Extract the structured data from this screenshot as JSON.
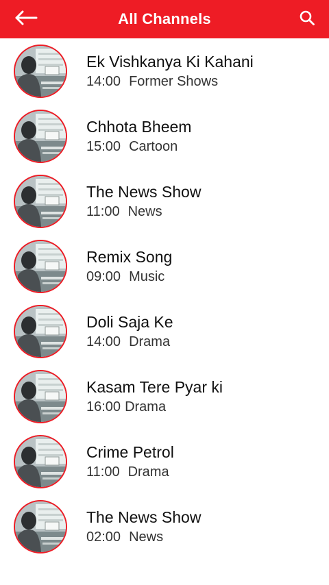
{
  "header": {
    "title": "All Channels",
    "background": "#ee1c25",
    "back_icon": "arrow-left-icon",
    "search_icon": "search-icon"
  },
  "channels": [
    {
      "name": "Ek Vishkanya Ki Kahani",
      "time": "14:00",
      "category": "Former Shows"
    },
    {
      "name": "Chhota Bheem",
      "time": "15:00",
      "category": "Cartoon"
    },
    {
      "name": "The News Show",
      "time": "11:00",
      "category": "News"
    },
    {
      "name": "Remix Song",
      "time": "09:00",
      "category": "Music"
    },
    {
      "name": "Doli Saja Ke",
      "time": "14:00",
      "category": "Drama"
    },
    {
      "name": "Kasam Tere Pyar ki",
      "time": "16:00",
      "category": "Drama"
    },
    {
      "name": "Crime Petrol",
      "time": "11:00",
      "category": "Drama"
    },
    {
      "name": "The News Show",
      "time": "02:00",
      "category": "News"
    }
  ]
}
